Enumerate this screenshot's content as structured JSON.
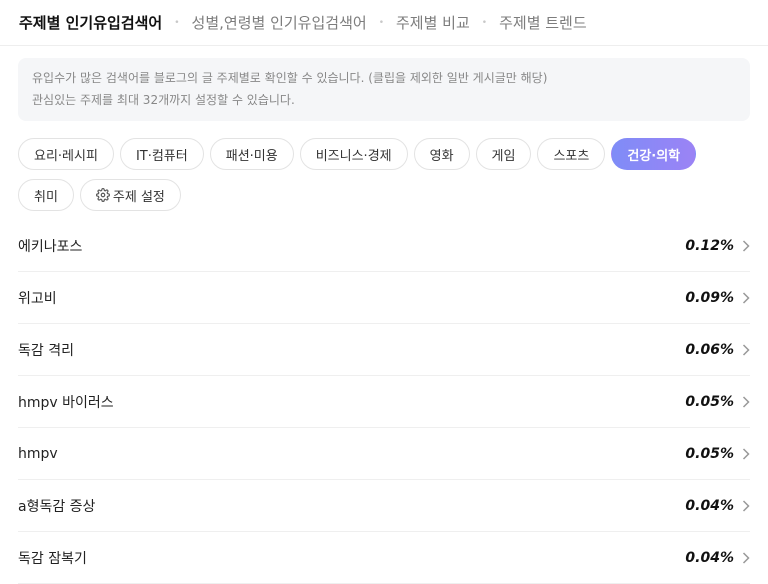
{
  "nav": {
    "items": [
      {
        "label": "주제별 인기유입검색어"
      },
      {
        "label": "성별,연령별 인기유입검색어"
      },
      {
        "label": "주제별 비교"
      },
      {
        "label": "주제별 트렌드"
      }
    ],
    "separator": "•"
  },
  "info": {
    "line1": "유입수가 많은 검색어를 블로그의 글 주제별로 확인할 수 있습니다. (클립을 제외한 일반 게시글만 해당)",
    "line2": "관심있는 주제를 최대 32개까지 설정할 수 있습니다."
  },
  "chips": {
    "row1": [
      {
        "label": "요리·레시피"
      },
      {
        "label": "IT·컴퓨터"
      },
      {
        "label": "패션·미용"
      },
      {
        "label": "비즈니스·경제"
      },
      {
        "label": "영화"
      },
      {
        "label": "게임"
      },
      {
        "label": "스포츠"
      },
      {
        "label": "건강·의학"
      }
    ],
    "row2": [
      {
        "label": "취미"
      },
      {
        "label": "주제 설정"
      }
    ],
    "active_color": "#8a88f6"
  },
  "keywords": [
    {
      "label": "에키나포스",
      "value": "0.12%"
    },
    {
      "label": "위고비",
      "value": "0.09%"
    },
    {
      "label": "독감 격리",
      "value": "0.06%"
    },
    {
      "label": "hmpv 바이러스",
      "value": "0.05%"
    },
    {
      "label": "hmpv",
      "value": "0.05%"
    },
    {
      "label": "a형독감 증상",
      "value": "0.04%"
    },
    {
      "label": "독감 잠복기",
      "value": "0.04%"
    }
  ]
}
